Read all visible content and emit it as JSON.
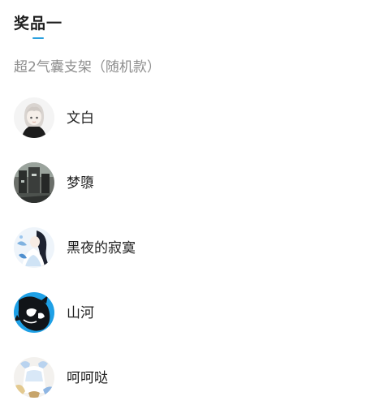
{
  "prize": {
    "title": "奖品一",
    "subtitle": "超2气囊支架（随机款）",
    "accent_color": "#2aa0de"
  },
  "winners": [
    {
      "name": "文白",
      "avatar_icon": "anime-girl-white-hair-avatar"
    },
    {
      "name": "梦隳",
      "avatar_icon": "dark-scene-avatar"
    },
    {
      "name": "黑夜的寂寞",
      "avatar_icon": "anime-girl-blue-dress-avatar"
    },
    {
      "name": "山河",
      "avatar_icon": "blue-ink-character-avatar"
    },
    {
      "name": "呵呵哒",
      "avatar_icon": "pastel-anime-avatar"
    }
  ]
}
